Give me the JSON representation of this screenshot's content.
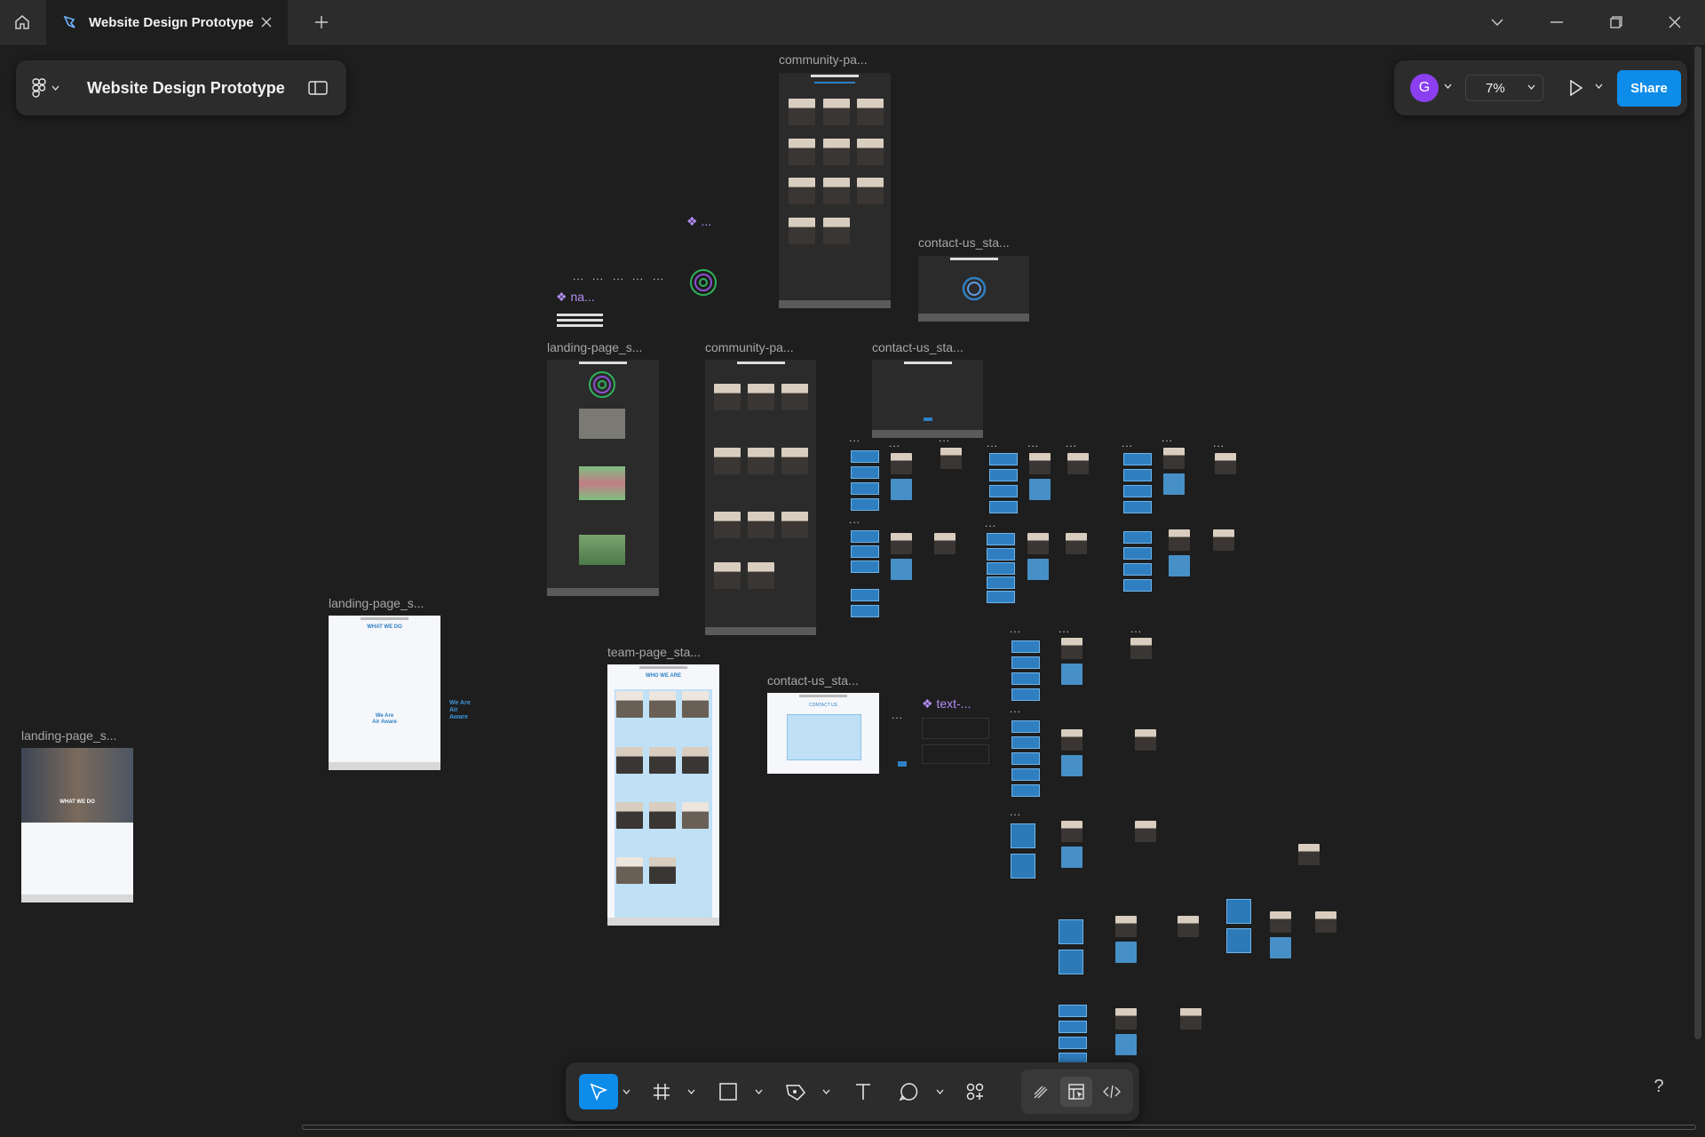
{
  "tab": {
    "title": "Website Design Prototype"
  },
  "file": {
    "name": "Website Design Prototype"
  },
  "user": {
    "initial": "G"
  },
  "zoom": {
    "value": "7%"
  },
  "share": {
    "label": "Share"
  },
  "frames": [
    {
      "label": "community-pa..."
    },
    {
      "label": "contact-us_sta..."
    },
    {
      "label": "landing-page_s..."
    },
    {
      "label": "community-pa..."
    },
    {
      "label": "contact-us_sta..."
    },
    {
      "label": "landing-page_s..."
    },
    {
      "label": "team-page_sta..."
    },
    {
      "label": "contact-us_sta..."
    },
    {
      "label": "landing-page_s..."
    }
  ],
  "components": [
    {
      "label": "na..."
    },
    {
      "label": "..."
    },
    {
      "label": "text-..."
    }
  ],
  "canvas_text": {
    "what_we_do": "WHAT WE DO",
    "we_are_air_aware": "We Are Air Aware",
    "who_we_are": "WHO WE ARE",
    "contact_us": "CONTACT US",
    "more": "..."
  },
  "help": {
    "label": "?"
  },
  "icons": {
    "home": "home-icon",
    "figma": "figma-logo-icon",
    "close": "close-icon",
    "plus": "plus-icon",
    "chevron": "chevron-down-icon",
    "minimize": "minimize-icon",
    "restore": "restore-icon",
    "panel": "sidebar-toggle-icon",
    "play": "play-icon",
    "move": "move-tool-icon",
    "frame": "frame-tool-icon",
    "rect": "rectangle-tool-icon",
    "pen": "pen-tool-icon",
    "text": "text-tool-icon",
    "comment": "comment-icon",
    "actions": "actions-icon",
    "draw": "draw-icon",
    "design": "design-mode-icon",
    "dev": "dev-mode-icon"
  },
  "colors": {
    "accent": "#0d8ce9",
    "component": "#b18ef5",
    "canvas": "#1e1e1e",
    "panel": "#2c2c2c"
  }
}
